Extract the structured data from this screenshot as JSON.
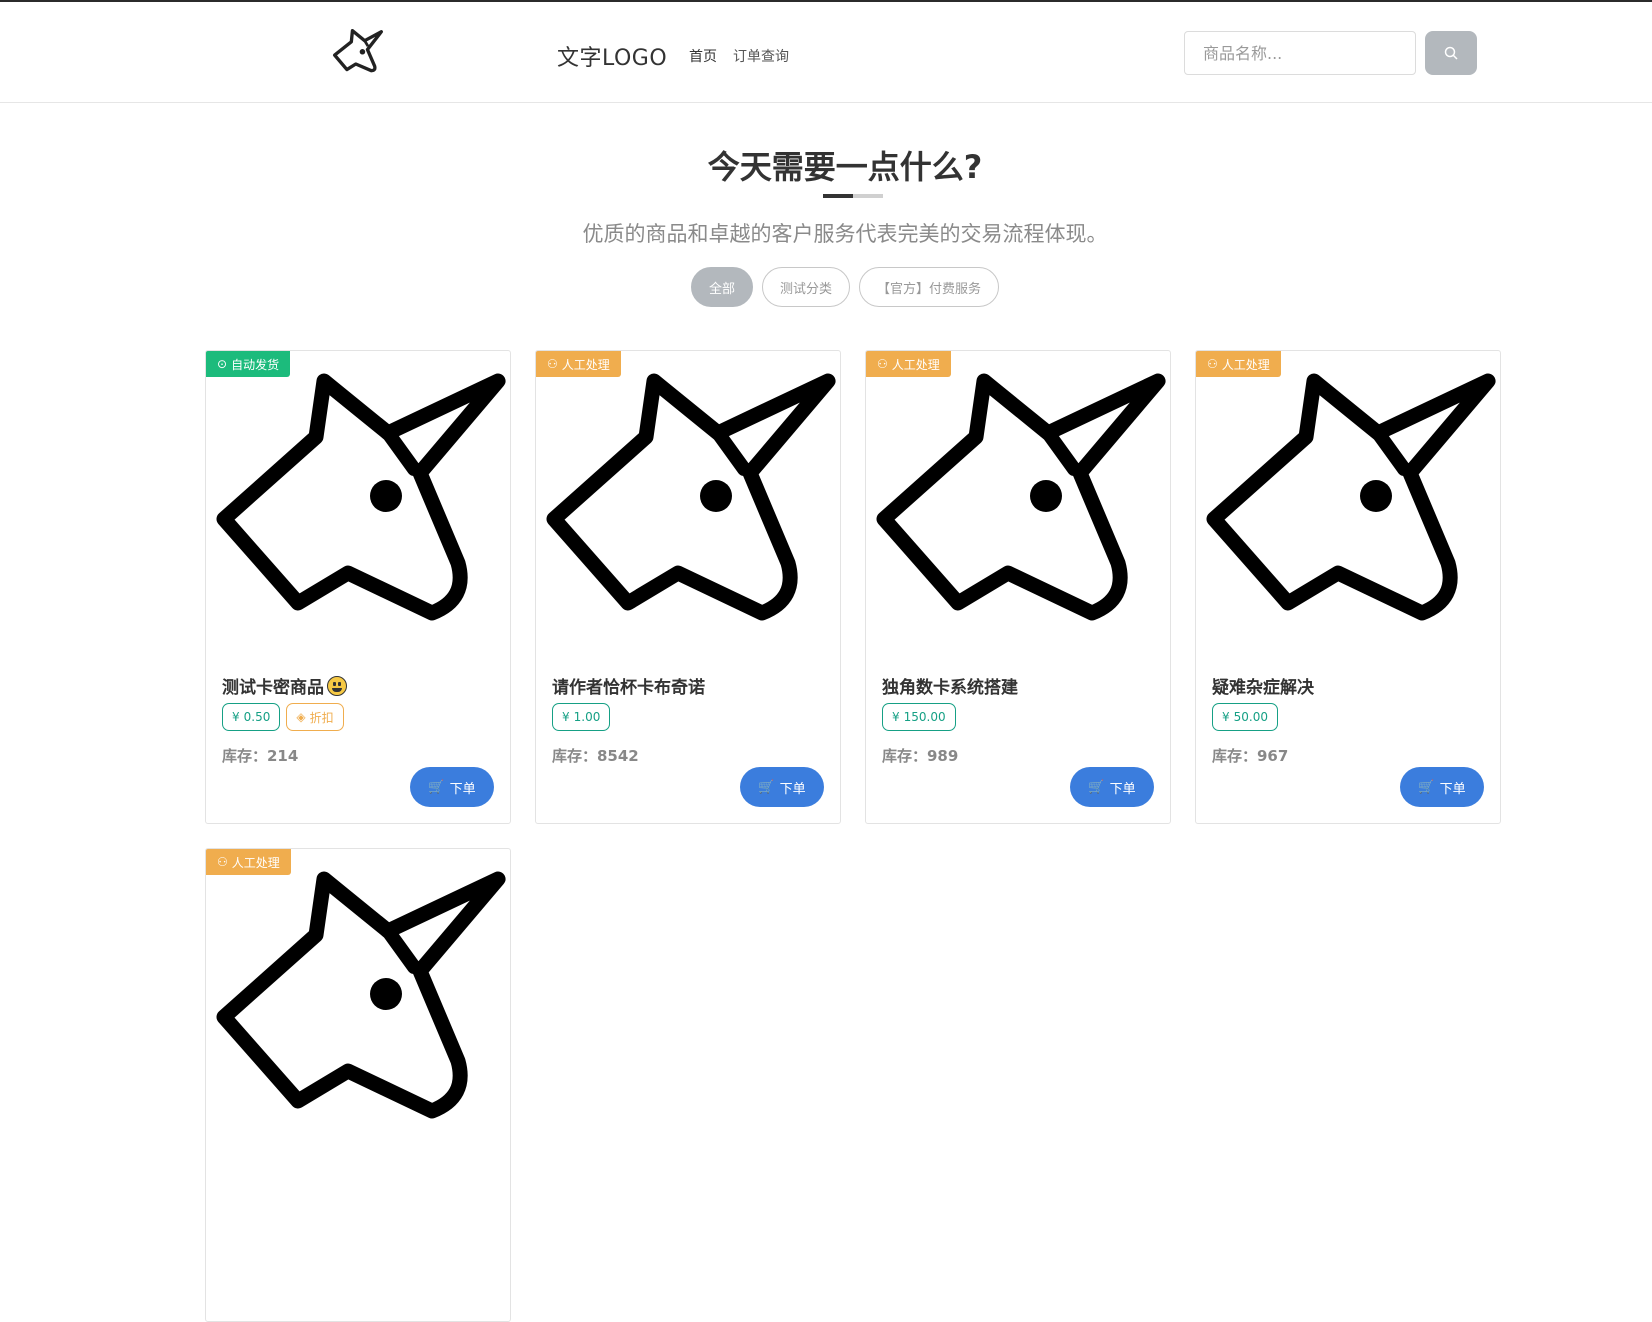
{
  "header": {
    "logo_text": "文字LOGO",
    "nav": [
      {
        "label": "首页"
      },
      {
        "label": "订单查询"
      }
    ],
    "search": {
      "placeholder": "商品名称..."
    }
  },
  "hero": {
    "title": "今天需要一点什么?",
    "subtitle": "优质的商品和卓越的客户服务代表完美的交易流程体现。"
  },
  "filters": [
    {
      "label": "全部",
      "active": true
    },
    {
      "label": "测试分类",
      "active": false
    },
    {
      "label": "【官方】付费服务",
      "active": false
    }
  ],
  "products": [
    {
      "badge": "自动发货",
      "badge_type": "auto",
      "name": "测试卡密商品",
      "price": "0.50",
      "discount": "折扣",
      "stock": "库存：214",
      "order_label": "下单"
    },
    {
      "badge": "人工处理",
      "badge_type": "manual",
      "name": "请作者恰杯卡布奇诺",
      "price": "1.00",
      "stock": "库存：8542",
      "order_label": "下单"
    },
    {
      "badge": "人工处理",
      "badge_type": "manual",
      "name": "独角数卡系统搭建",
      "price": "150.00",
      "stock": "库存：989",
      "order_label": "下单"
    },
    {
      "badge": "人工处理",
      "badge_type": "manual",
      "name": "疑难杂症解决",
      "price": "50.00",
      "stock": "库存：967",
      "order_label": "下单"
    },
    {
      "badge": "人工处理",
      "badge_type": "manual"
    }
  ],
  "colors": {
    "auto_badge": "#1cbb7c",
    "manual_badge": "#f0ad4e",
    "order_button": "#3b7ddd",
    "price_tag": "#16a085"
  }
}
